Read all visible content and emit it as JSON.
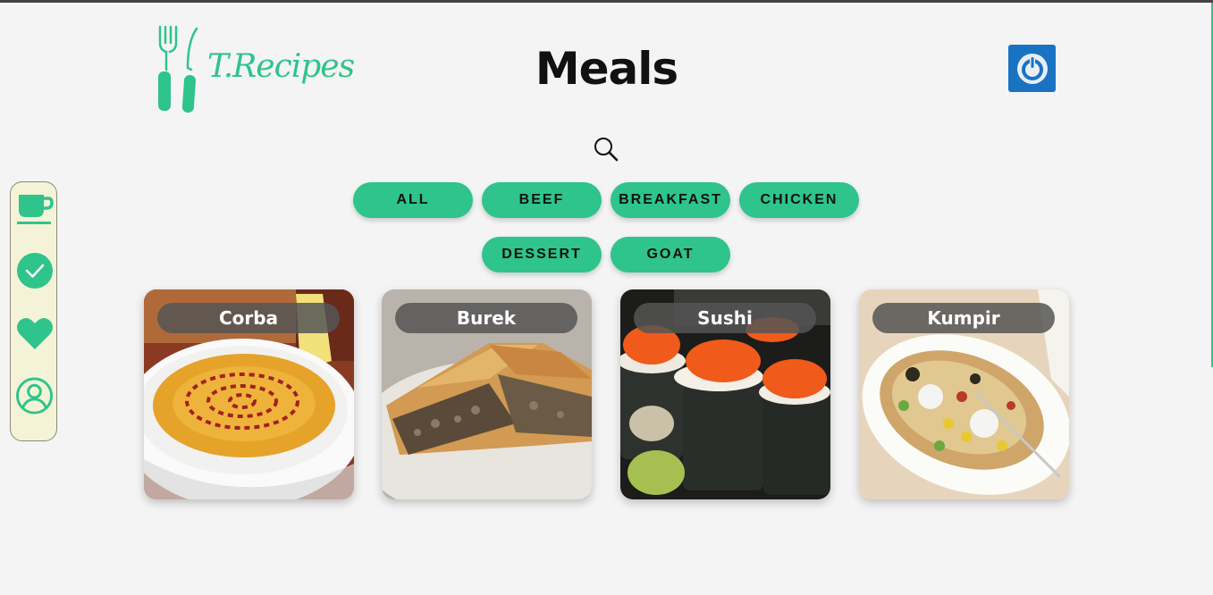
{
  "header": {
    "logo_text": "T.Recipes",
    "title": "Meals",
    "power_icon": "power-icon",
    "search_icon": "search-icon"
  },
  "sidebar": {
    "items": [
      {
        "icon": "cup-icon",
        "name": "meals"
      },
      {
        "icon": "check-circle-icon",
        "name": "done"
      },
      {
        "icon": "heart-icon",
        "name": "favorites"
      },
      {
        "icon": "user-icon",
        "name": "profile"
      }
    ]
  },
  "filters": [
    "ALL",
    "BEEF",
    "BREAKFAST",
    "CHICKEN",
    "DESSERT",
    "GOAT"
  ],
  "meals": [
    {
      "name": "Corba"
    },
    {
      "name": "Burek"
    },
    {
      "name": "Sushi"
    },
    {
      "name": "Kumpir"
    }
  ],
  "colors": {
    "accent": "#2ec48c",
    "power_button": "#1a73c2",
    "sidebar_bg": "#f5f3d7",
    "background": "#f4f4f4"
  }
}
